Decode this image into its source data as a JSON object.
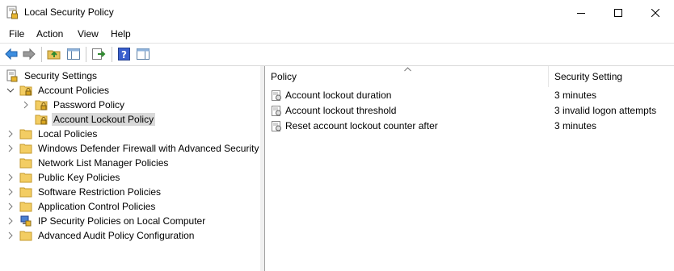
{
  "window": {
    "title": "Local Security Policy"
  },
  "menu": {
    "file": "File",
    "action": "Action",
    "view": "View",
    "help": "Help"
  },
  "tree": {
    "root": "Security Settings",
    "account_policies": "Account Policies",
    "password_policy": "Password Policy",
    "account_lockout_policy": "Account Lockout Policy",
    "local_policies": "Local Policies",
    "firewall": "Windows Defender Firewall with Advanced Security",
    "network_list": "Network List Manager Policies",
    "public_key": "Public Key Policies",
    "software_restriction": "Software Restriction Policies",
    "app_control": "Application Control Policies",
    "ip_security": "IP Security Policies on Local Computer",
    "audit": "Advanced Audit Policy Configuration"
  },
  "list": {
    "columns": {
      "policy": "Policy",
      "setting": "Security Setting"
    },
    "rows": [
      {
        "policy": "Account lockout duration",
        "setting": "3 minutes"
      },
      {
        "policy": "Account lockout threshold",
        "setting": "3 invalid logon attempts"
      },
      {
        "policy": "Reset account lockout counter after",
        "setting": "3 minutes"
      }
    ]
  },
  "colors": {
    "selection": "#d9d9d9",
    "folder": "#f3cd63",
    "accent": "#1e70c8"
  }
}
